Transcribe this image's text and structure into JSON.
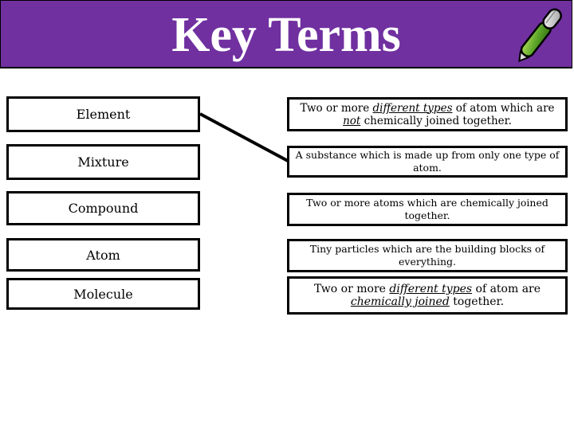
{
  "header": {
    "title": "Key Terms",
    "icon": "pen-icon",
    "background_color": "#7030a0"
  },
  "terms": [
    {
      "label": "Element"
    },
    {
      "label": "Mixture"
    },
    {
      "label": "Compound"
    },
    {
      "label": "Atom"
    },
    {
      "label": "Molecule"
    }
  ],
  "definitions": [
    {
      "parts": [
        "Two or more ",
        "different types",
        " of atom which are ",
        "not",
        " chemically joined together."
      ]
    },
    {
      "text": "A substance which is made up from only one type of atom."
    },
    {
      "text": "Two or more atoms which are chemically joined together."
    },
    {
      "text": "Tiny particles which are the building blocks of everything."
    },
    {
      "parts": [
        "Two or more ",
        "different types",
        " of atom are ",
        "chemically joined",
        " together."
      ]
    }
  ],
  "connections": [
    {
      "from_term": "Element",
      "to_definition": "A substance which is made up from only one type of atom."
    }
  ]
}
